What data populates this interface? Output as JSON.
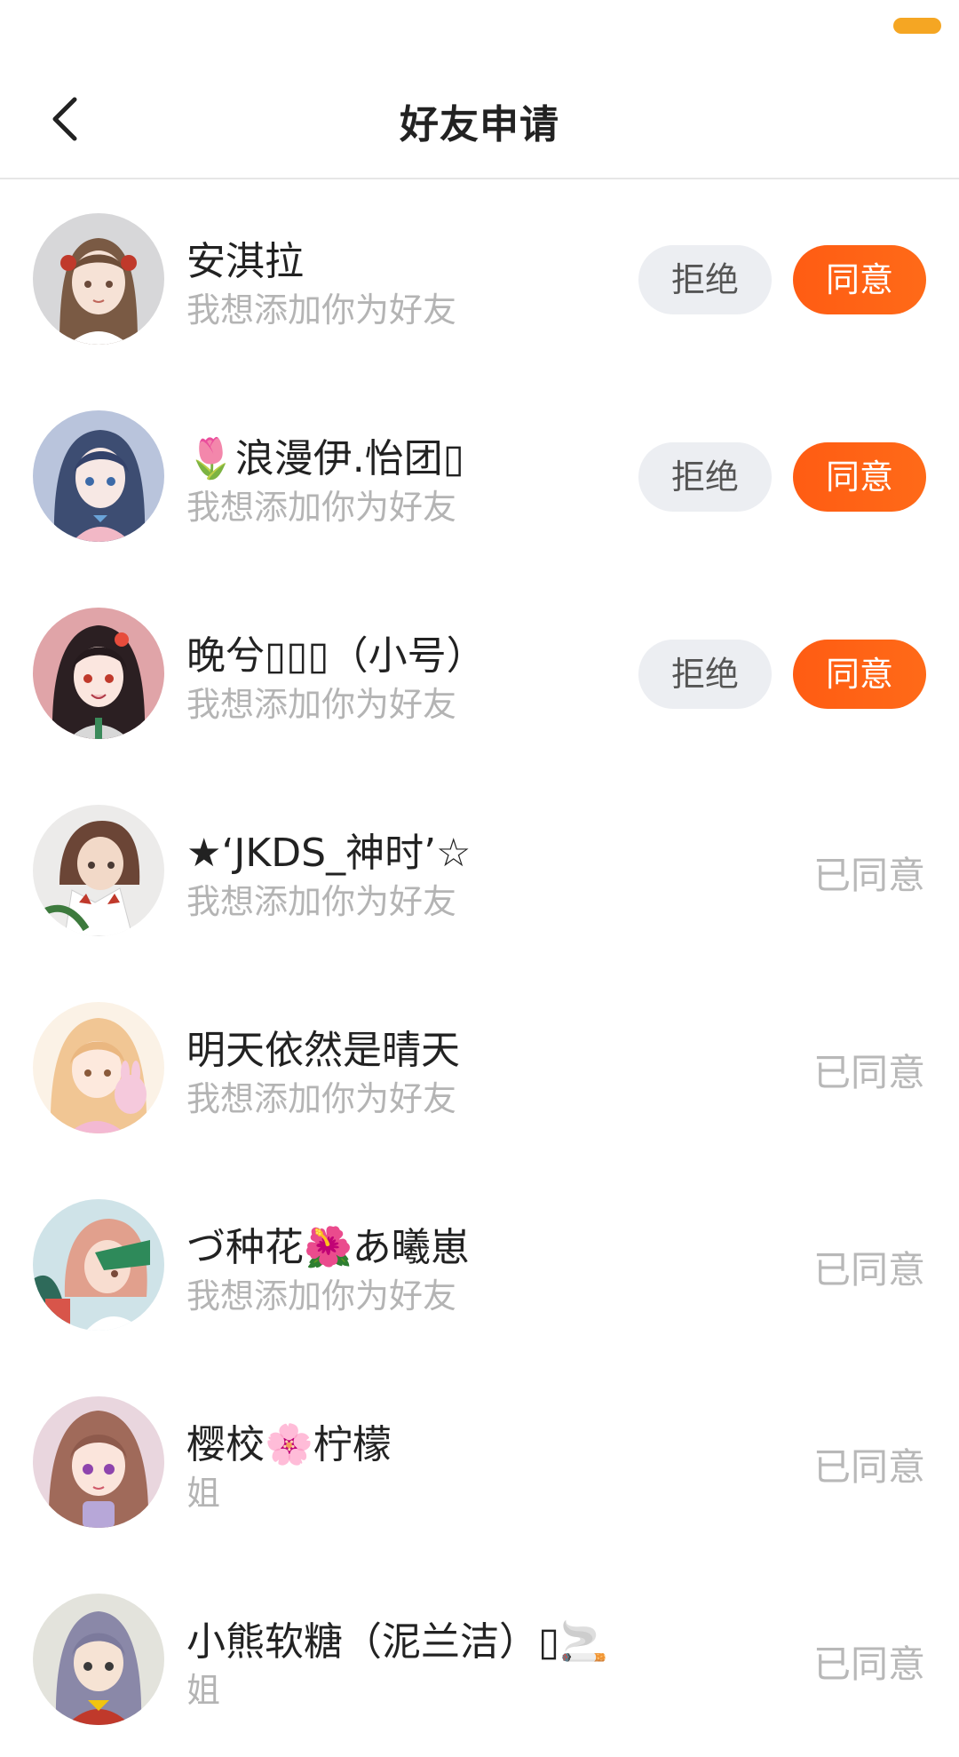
{
  "header": {
    "title": "好友申请"
  },
  "colors": {
    "accent": "#FF5C13",
    "battery": "#F5A623",
    "reject_bg": "#ECEEF2",
    "muted_text": "#B4B4B4"
  },
  "requests": [
    {
      "name": "安淇拉",
      "message": "我想添加你为好友",
      "reject_label": "拒绝",
      "accept_label": "同意"
    },
    {
      "name": "🌷浪漫伊.怡团▯",
      "message": "我想添加你为好友",
      "reject_label": "拒绝",
      "accept_label": "同意"
    },
    {
      "name": "晚兮▯▯▯（小号）",
      "message": "我想添加你为好友",
      "reject_label": "拒绝",
      "accept_label": "同意"
    },
    {
      "name": "★‘JKDS_神时’☆",
      "message": "我想添加你为好友",
      "status": "已同意"
    },
    {
      "name": "明天依然是晴天",
      "message": "我想添加你为好友",
      "status": "已同意"
    },
    {
      "name": "づ种花🌺あ曦崽",
      "message": "我想添加你为好友",
      "status": "已同意"
    },
    {
      "name": "樱校🌸柠檬",
      "message": "姐",
      "status": "已同意"
    },
    {
      "name": "小熊软糖（泥兰洁）▯🚬",
      "message": "姐",
      "status": "已同意"
    }
  ]
}
